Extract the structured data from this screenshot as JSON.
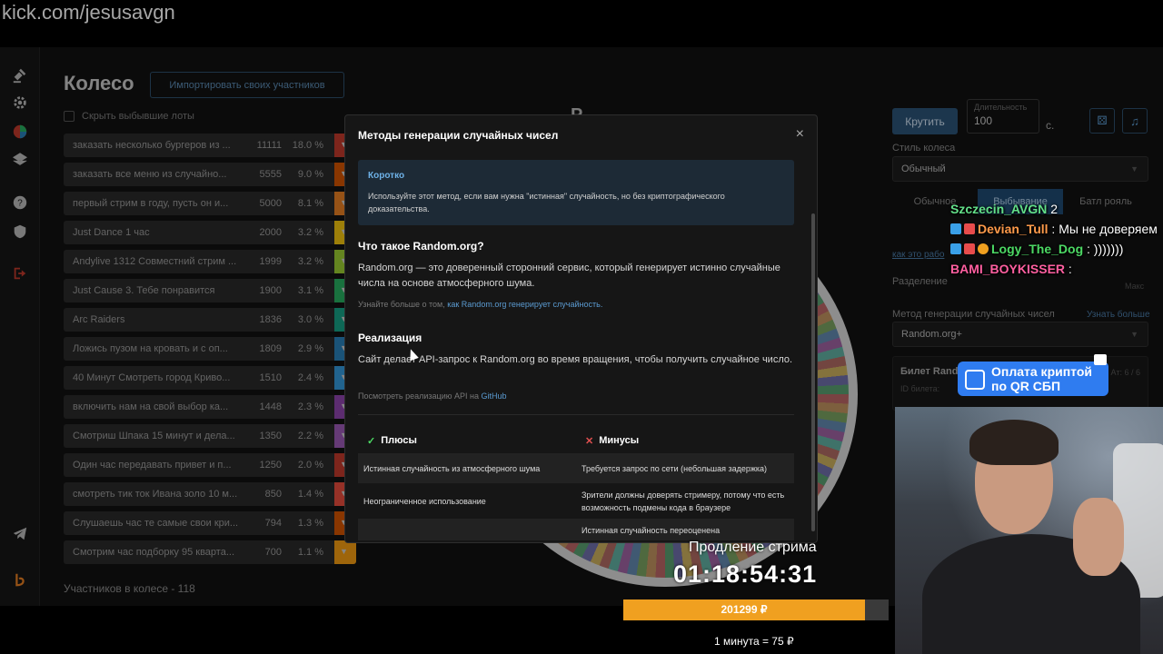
{
  "browser": {
    "url": "kick.com/jesusavgn"
  },
  "sidebar": {
    "icons": [
      "gavel-icon",
      "gear-icon",
      "pie-chart-icon",
      "layers-icon",
      "help-icon",
      "shield-icon",
      "logout-icon",
      "telegram-icon",
      "brand-logo-icon"
    ]
  },
  "page": {
    "title": "Колесо",
    "import_button": "Импортировать своих участников",
    "hide_dropped_label": "Скрыть выбывшие лоты",
    "participants_count": "Участников в колесе - 118"
  },
  "lots": [
    {
      "name": "заказать несколько бургеров из ...",
      "amount": "11111",
      "percent": "18.0 %",
      "color": "#c0392b"
    },
    {
      "name": "заказать все меню из случайно...",
      "amount": "5555",
      "percent": "9.0 %",
      "color": "#d35400"
    },
    {
      "name": "первый стрим в году, пусть он и...",
      "amount": "5000",
      "percent": "8.1 %",
      "color": "#e67e22"
    },
    {
      "name": "Just Dance 1 час",
      "amount": "2000",
      "percent": "3.2 %",
      "color": "#f1c40f"
    },
    {
      "name": "Andylive 1312 Совместний стрим ...",
      "amount": "1999",
      "percent": "3.2 %",
      "color": "#9acd32"
    },
    {
      "name": "Just Cause 3. Тебе понравится",
      "amount": "1900",
      "percent": "3.1 %",
      "color": "#27ae60"
    },
    {
      "name": "Arc Raiders",
      "amount": "1836",
      "percent": "3.0 %",
      "color": "#16a085"
    },
    {
      "name": "Ложись пузом на кровать и с оп...",
      "amount": "1809",
      "percent": "2.9 %",
      "color": "#2980b9"
    },
    {
      "name": "40 Минут Смотреть город Криво...",
      "amount": "1510",
      "percent": "2.4 %",
      "color": "#3498db"
    },
    {
      "name": "включить нам на свой выбор ка...",
      "amount": "1448",
      "percent": "2.3 %",
      "color": "#8e44ad"
    },
    {
      "name": "Смотриш Шпака 15 минут и дела...",
      "amount": "1350",
      "percent": "2.2 %",
      "color": "#9b59b6"
    },
    {
      "name": "Один час передавать привет и п...",
      "amount": "1250",
      "percent": "2.0 %",
      "color": "#c0392b"
    },
    {
      "name": "смотреть тик ток Ивана золо 10 м...",
      "amount": "850",
      "percent": "1.4 %",
      "color": "#e74c3c"
    },
    {
      "name": "Слушаешь час те самые свои кри...",
      "amount": "794",
      "percent": "1.3 %",
      "color": "#d35400"
    },
    {
      "name": "Смотрим час подборку 95 кварта...",
      "amount": "700",
      "percent": "1.1 %",
      "color": "#f39c12"
    }
  ],
  "wheel_panel": {
    "heading_partial": "Р",
    "spin_button": "Крутить",
    "duration_label": "Длительность",
    "duration_value": "100",
    "duration_unit": "с.",
    "wheel_style_label": "Стиль колеса",
    "wheel_style_value": "Обычный",
    "mode_tabs": [
      "Обычное",
      "Выбывание",
      "Батл рояль"
    ],
    "active_mode": "Выбывание",
    "how_it_works_link": "как это рабо",
    "split_label": "Разделение",
    "split_right": "Макс",
    "rng_method_label": "Метод генерации случайных чисел",
    "learn_more_link": "Узнать больше",
    "rng_method_value": "Random.org+",
    "ticket_title": "Билет Rando",
    "ticket_sub": "ID билета:",
    "ticket_right": "Ат: 6 / 6"
  },
  "modal": {
    "title": "Методы генерации случайных чисел",
    "close_label": "×",
    "callout_heading": "Коротко",
    "callout_text": "Используйте этот метод, если вам нужна \"истинная\" случайность, но без криптографического доказательства.",
    "section1_heading": "Что такое Random.org?",
    "section1_text": "Random.org — это доверенный сторонний сервис, который генерирует истинно случайные числа на основе атмосферного шума.",
    "section1_more_prefix": "Узнайте больше о том, ",
    "section1_more_link": "как Random.org генерирует случайность.",
    "section2_heading": "Реализация",
    "section2_text": "Сайт делает API-запрос к Random.org во время вращения, чтобы получить случайное число.",
    "section2_more_prefix": "Посмотреть реализацию API на ",
    "section2_more_link": "GitHub",
    "pros_header": "Плюсы",
    "cons_header": "Минусы",
    "rows": [
      {
        "pro": "Истинная случайность из атмосферного шума",
        "con": "Требуется запрос по сети (небольшая задержка)"
      },
      {
        "pro": "Неограниченное использование",
        "con": "Зрители должны доверять стримеру, потому что есть возможность подмены кода в браузере"
      },
      {
        "pro": "",
        "con": "Истинная случайность переоценена"
      }
    ]
  },
  "overlay": {
    "chat": [
      {
        "nick": "Szczecin_AVGN",
        "text": " 2"
      },
      {
        "nick": "Devian_Tull",
        "text": " : Мы не доверяем"
      },
      {
        "nick": "Logy_The_Dog",
        "text": " : )))))))"
      },
      {
        "nick": "BAMI_BOYKISSER",
        "text": " :"
      }
    ],
    "pay_banner_line1": "Оплата криптой",
    "pay_banner_line2": "по QR СБП",
    "stream_extension_label": "Продление стрима",
    "timer": "01:18:54:31",
    "donation_total": "201299 ₽",
    "donation_progress": 0.91,
    "rate": "1 минута = 75 ₽"
  },
  "colors": {
    "accent": "#2b5377",
    "bar": "#f0a020",
    "modal_bg": "#161616",
    "link": "#5b9bd1"
  }
}
